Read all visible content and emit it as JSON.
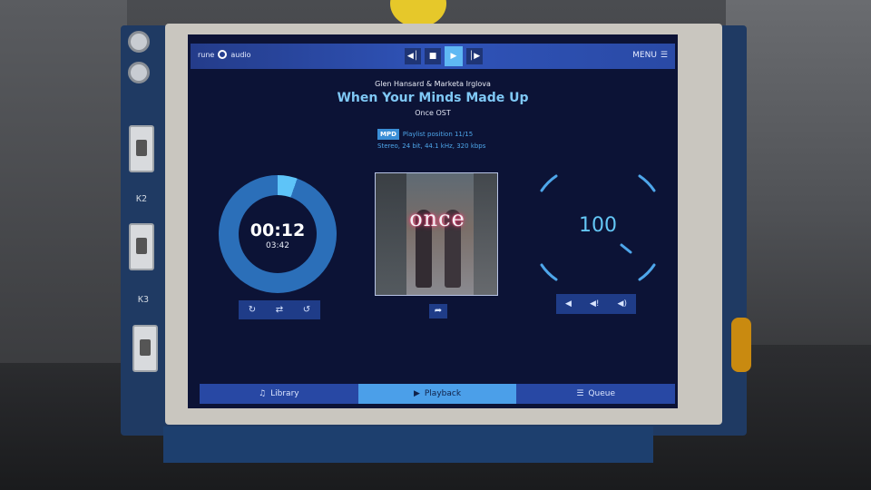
{
  "app": {
    "logo_text_1": "rune",
    "logo_text_2": "audio",
    "menu_label": "MENU"
  },
  "track": {
    "artist": "Glen Hansard & Marketa Irglova",
    "title": "When Your Minds Made Up",
    "album": "Once OST"
  },
  "stream": {
    "source_badge": "MPD",
    "playlist_position": "Playlist position 11/15",
    "format": "Stereo, 24 bit, 44.1 kHz, 320 kbps"
  },
  "timer": {
    "elapsed": "00:12",
    "total": "03:42",
    "progress": 0.054
  },
  "cover": {
    "word": "once"
  },
  "volume": {
    "level": "100"
  },
  "tabs": {
    "library": "Library",
    "playback": "Playback",
    "queue": "Queue"
  },
  "board_labels": {
    "k2": "K2",
    "k3": "K3"
  },
  "colors": {
    "screen_bg": "#0c1336",
    "accent": "#4ea6ea",
    "bar_blue": "#2848a4",
    "active_tab": "#4b9fe9"
  }
}
